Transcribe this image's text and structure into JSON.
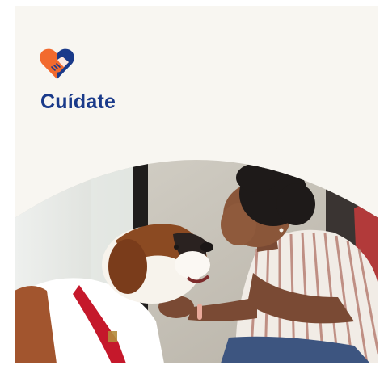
{
  "brand": {
    "name": "Cuídate",
    "logo_icon": "heart-handshake-icon",
    "colors": {
      "heart_orange": "#f26a2e",
      "heart_navy": "#1a3a8a",
      "text_navy": "#1a3a8a",
      "background": "#f8f6f1"
    }
  },
  "hero": {
    "image": "woman-with-saint-bernard-dog-photo"
  }
}
